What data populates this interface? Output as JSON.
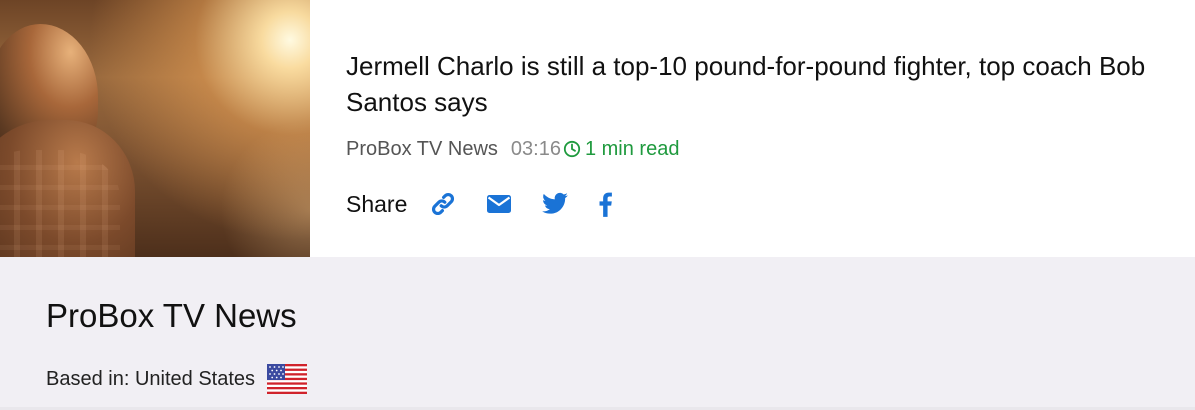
{
  "article": {
    "image_alt": "silhouette-at-sunset",
    "title": "Jermell Charlo is still a top-10 pound-for-pound fighter, top coach Bob Santos says",
    "source": "ProBox TV News",
    "time": "03:16",
    "read_time": "1 min read",
    "share_label": "Share",
    "share_icons": [
      "link-icon",
      "envelope-icon",
      "twitter-icon",
      "facebook-icon"
    ],
    "accent_color": "#1a73d6",
    "read_time_color": "#1f9a3e"
  },
  "source_panel": {
    "name": "ProBox TV News",
    "based_in": "Based in: United States",
    "flag_icon": "us-flag-icon"
  }
}
